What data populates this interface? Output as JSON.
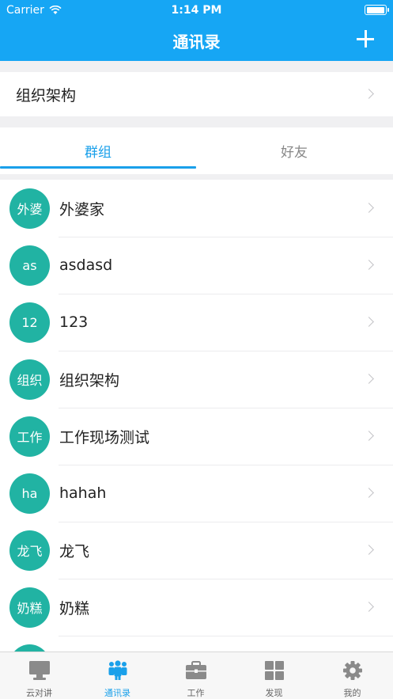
{
  "status_bar": {
    "carrier": "Carrier",
    "time": "1:14 PM"
  },
  "nav": {
    "title": "通讯录",
    "add_icon": "plus-icon"
  },
  "org": {
    "label": "组织架构"
  },
  "tabs": [
    {
      "label": "群组",
      "active": true
    },
    {
      "label": "好友",
      "active": false
    }
  ],
  "groups": [
    {
      "avatar": "外婆",
      "name": "外婆家"
    },
    {
      "avatar": "as",
      "name": "asdasd"
    },
    {
      "avatar": "12",
      "name": "123"
    },
    {
      "avatar": "组织",
      "name": "组织架构"
    },
    {
      "avatar": "工作",
      "name": "工作现场测试"
    },
    {
      "avatar": "ha",
      "name": "hahah"
    },
    {
      "avatar": "龙飞",
      "name": "龙飞"
    },
    {
      "avatar": "奶糕",
      "name": "奶糕"
    },
    {
      "avatar": "",
      "name": ""
    }
  ],
  "tabbar": [
    {
      "label": "云对讲",
      "icon": "monitor-icon",
      "active": false
    },
    {
      "label": "通讯录",
      "icon": "contacts-icon",
      "active": true
    },
    {
      "label": "工作",
      "icon": "briefcase-icon",
      "active": false
    },
    {
      "label": "发现",
      "icon": "grid-icon",
      "active": false
    },
    {
      "label": "我的",
      "icon": "gear-icon",
      "active": false
    }
  ],
  "colors": {
    "nav_bg": "#16a6f4",
    "accent": "#1aa0ea",
    "avatar_bg": "#21b3a3"
  }
}
